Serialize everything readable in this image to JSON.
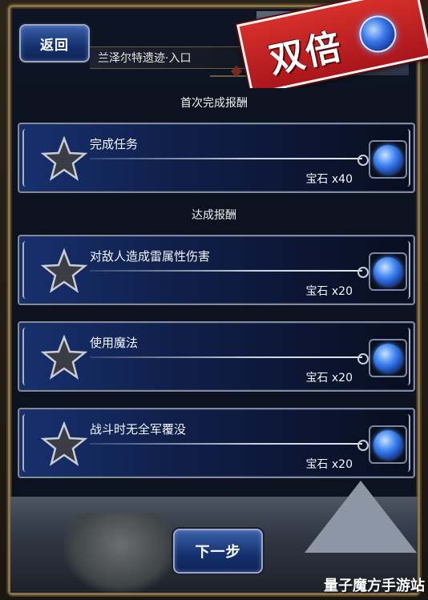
{
  "header": {
    "back_label": "返回",
    "location": "兰泽尔特遗迹·入口"
  },
  "banner": {
    "text": "双倍",
    "gem_icon": "blue-gem-icon"
  },
  "sections": {
    "first_clear": "首次完成报酬",
    "achievement": "达成报酬"
  },
  "tasks": [
    {
      "title": "完成任务",
      "reward": "宝石 x40",
      "star_icon": "star-icon",
      "reward_icon": "blue-gem-icon"
    },
    {
      "title": "对敌人造成雷属性伤害",
      "reward": "宝石 x20",
      "star_icon": "star-icon",
      "reward_icon": "blue-gem-icon"
    },
    {
      "title": "使用魔法",
      "reward": "宝石 x20",
      "star_icon": "star-icon",
      "reward_icon": "blue-gem-icon"
    },
    {
      "title": "战斗时无全军覆没",
      "reward": "宝石 x20",
      "star_icon": "star-icon",
      "reward_icon": "blue-gem-icon"
    }
  ],
  "footer": {
    "next_label": "下一步"
  },
  "watermark": "量子魔方手游站",
  "colors": {
    "button_blue": "#14306e",
    "banner_red": "#c41f22",
    "gem_blue": "#3c82f0",
    "frame_gold": "#8a7449"
  }
}
